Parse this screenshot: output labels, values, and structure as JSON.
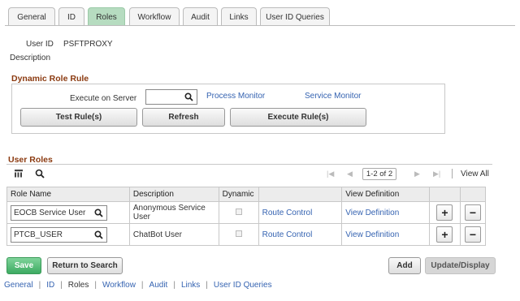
{
  "tabs": [
    {
      "label": "General",
      "active": false
    },
    {
      "label": "ID",
      "active": false
    },
    {
      "label": "Roles",
      "active": true
    },
    {
      "label": "Workflow",
      "active": false
    },
    {
      "label": "Audit",
      "active": false
    },
    {
      "label": "Links",
      "active": false
    },
    {
      "label": "User ID Queries",
      "active": false
    }
  ],
  "header": {
    "user_id_label": "User ID",
    "user_id_value": "PSFTPROXY",
    "description_label": "Description"
  },
  "dynamic_role_rule": {
    "title": "Dynamic Role Rule",
    "execute_on_server_label": "Execute on Server",
    "execute_on_server_value": "",
    "process_monitor_link": "Process Monitor",
    "service_monitor_link": "Service Monitor",
    "test_rules_button": "Test Rule(s)",
    "refresh_button": "Refresh",
    "execute_rules_button": "Execute Rule(s)"
  },
  "user_roles": {
    "title": "User Roles",
    "pager_text": "1-2 of 2",
    "view_all": "View All",
    "columns": [
      "Role Name",
      "Description",
      "Dynamic",
      "",
      "View Definition",
      "",
      ""
    ],
    "rows": [
      {
        "role_name": "EOCB Service User",
        "description": "Anonymous Service User",
        "dynamic": false,
        "route_control": "Route Control",
        "view_definition": "View Definition"
      },
      {
        "role_name": "PTCB_USER",
        "description": "ChatBot User",
        "dynamic": false,
        "route_control": "Route Control",
        "view_definition": "View Definition"
      }
    ]
  },
  "footer": {
    "save_button": "Save",
    "return_button": "Return to Search",
    "add_button": "Add",
    "update_display_button": "Update/Display",
    "links": [
      "General",
      "ID",
      "Roles",
      "Workflow",
      "Audit",
      "Links",
      "User ID Queries"
    ]
  },
  "colors": {
    "active_tab": "#b6dcc0",
    "section_title": "#8b3a10",
    "link": "#3563b1",
    "save": "#3dab62"
  }
}
